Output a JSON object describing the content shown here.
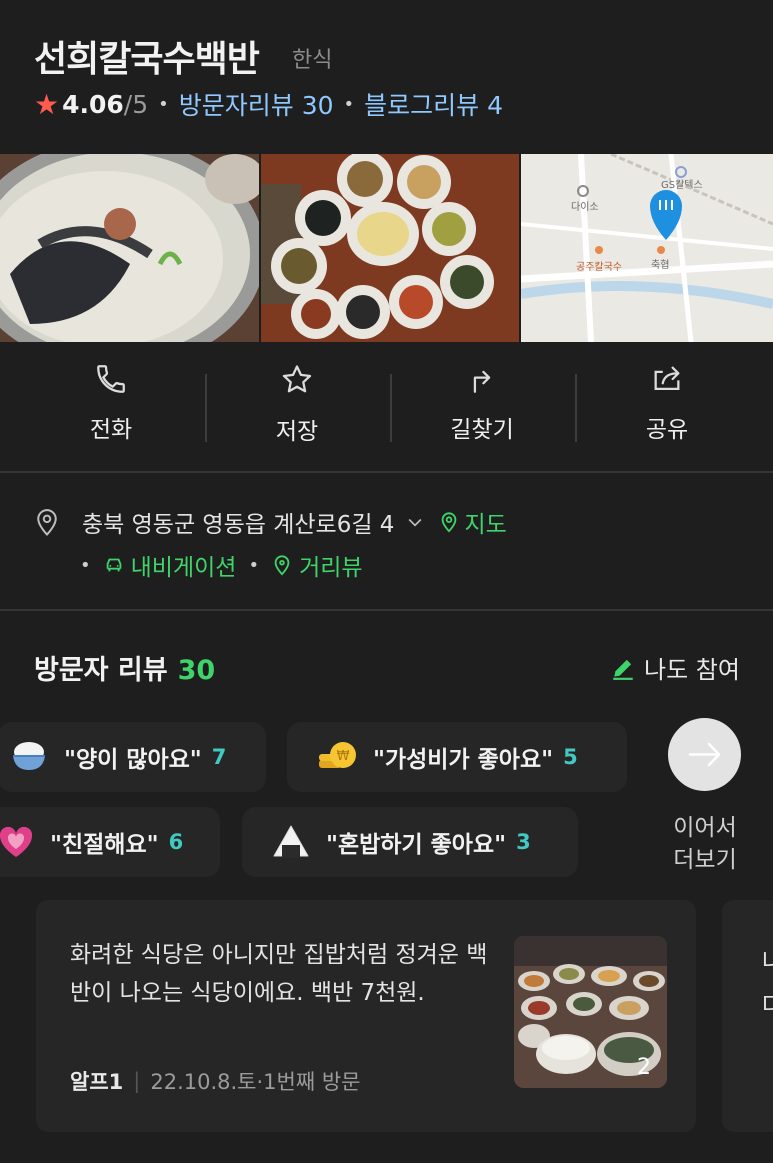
{
  "place": {
    "name": "선희칼국수백반",
    "category": "한식",
    "rating": "4.06",
    "rating_max": "/5",
    "visitor_reviews": "방문자리뷰 30",
    "blog_reviews": "블로그리뷰 4"
  },
  "photos": {
    "map_labels": {
      "daiso": "다이소",
      "gs": "GS칼텍스",
      "gongju": "공주칼국수",
      "nonghyup": "축협"
    }
  },
  "actions": {
    "call": "전화",
    "save": "저장",
    "directions": "길찾기",
    "share": "공유"
  },
  "address": {
    "text": "충북 영동군 영동읍 계산로6길 4",
    "map_link": "지도",
    "navigation_link": "내비게이션",
    "street_view_link": "거리뷰"
  },
  "reviews": {
    "title": "방문자 리뷰",
    "count": "30",
    "join_label": "나도 참여",
    "chips": [
      {
        "text": "\"양이 많아요\"",
        "count": "7",
        "icon": "rice-bowl-icon"
      },
      {
        "text": "\"가성비가 좋아요\"",
        "count": "5",
        "icon": "coins-icon"
      },
      {
        "text": "\"친절해요\"",
        "count": "6",
        "icon": "heart-icon"
      },
      {
        "text": "\"혼밥하기 좋아요\"",
        "count": "3",
        "icon": "rice-ball-icon"
      }
    ],
    "more_line1": "이어서",
    "more_line2": "더보기",
    "card": {
      "text": "화려한 식당은 아니지만 집밥처럼 정겨운 백반이 나오는 식당이에요. 백반 7천원.",
      "author": "알프1",
      "meta": "22.10.8.토·1번째 방문",
      "photo_count": "2"
    },
    "card2_peek": "나\n다"
  },
  "colors": {
    "accent_green": "#3fd46a",
    "link_blue": "#8fc8ff",
    "star_red": "#ff5a4f",
    "count_teal": "#41c9c2"
  }
}
